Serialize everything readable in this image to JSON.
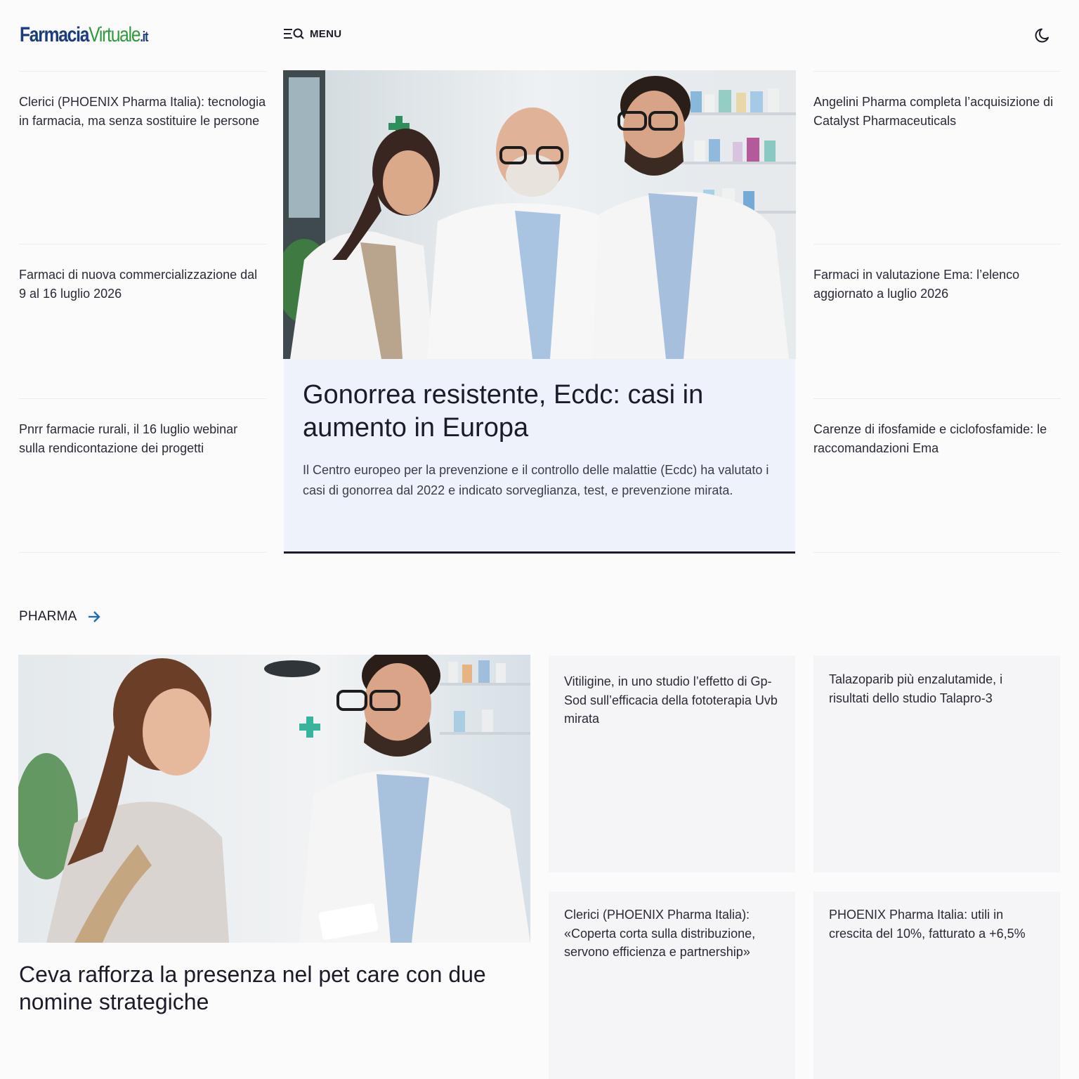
{
  "header": {
    "logo": {
      "part1": "Farmacia",
      "part2": "Virtuale",
      "part3": ".it"
    },
    "menu_label": "MENU",
    "icons": {
      "menu": "menu-search-icon",
      "theme": "moon-icon"
    }
  },
  "left_column": [
    "Clerici (PHOENIX Pharma Italia): tecnologia in farmacia, ma senza sostituire le persone",
    "Farmaci di nuova commercializzazione dal 9 al 16 luglio 2026",
    "Pnrr farmacie rurali, il 16 luglio webinar sulla rendicontazione dei progetti"
  ],
  "right_column": [
    "Angelini Pharma completa l’acquisizione di Catalyst Pharmaceuticals",
    "Farmaci in valutazione Ema: l’elenco aggiornato a luglio 2026",
    "Carenze di ifosfamide e ciclofosfamide: le raccomandazioni Ema"
  ],
  "hero": {
    "title": "Gonorrea resistente, Ecdc: casi in aumento in Europa",
    "description": "Il Centro europeo per la prevenzione e il controllo delle malattie (Ecdc) ha valutato i casi di gonorrea dal 2022 e indicato sorveglianza, test, e prevenzione mirata."
  },
  "pharma": {
    "section_label": "PHARMA",
    "main_title": "Ceva rafforza la presenza nel pet care con due nomine strategiche",
    "cards": [
      "Vitiligine, in uno studio l’effetto di Gp-Sod sull’efficacia della fototerapia Uvb mirata",
      "Talazoparib più enzalutamide, i risultati dello studio Talapro-3",
      "Clerici (PHOENIX Pharma Italia): «Coperta corta sulla distribuzione, servono efficienza e partnership»",
      "PHOENIX Pharma Italia: utili in crescita del 10%, fatturato a +6,5%"
    ]
  },
  "colors": {
    "accent_blue": "#1a6fb0",
    "logo_blue": "#1a3d7c",
    "logo_green": "#2f9a3c",
    "hero_bg": "#eef2fb",
    "card_bg": "#f5f4f7"
  }
}
